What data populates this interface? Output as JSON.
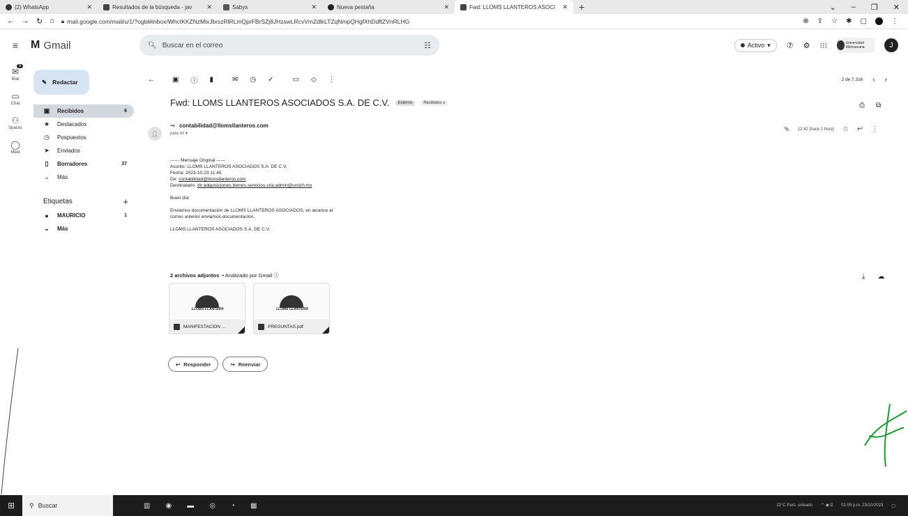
{
  "browser": {
    "tabs": [
      {
        "label": "(2) WhatsApp",
        "color": "#2a2a2a"
      },
      {
        "label": "Resultados de la búsqueda - jav",
        "color": "#2a2a2a"
      },
      {
        "label": "Sabys",
        "color": "#2a2a2a"
      },
      {
        "label": "Nueva pestaña",
        "color": "#2a2a2a"
      },
      {
        "label": "Fwd: LLOMS LLANTEROS ASOCI",
        "color": "#2a2a2a"
      }
    ],
    "url": "mail.google.com/mail/u/1/?ogbl#inbox/WhctKKZNzMlxJbrszRlRLmQprFBrSZj8JHzswLRcvVmZdlkLTZqNmpQHgfXhDdftZVnRLHG"
  },
  "gmail": {
    "logo": "Gmail",
    "search_placeholder": "Buscar en el correo",
    "status": "Activo",
    "org": "Universidad Michoacana",
    "avatar_letter": "J"
  },
  "rail": [
    {
      "label": "Mail",
      "badge": "9"
    },
    {
      "label": "Chat"
    },
    {
      "label": "Spaces"
    },
    {
      "label": "Meet"
    }
  ],
  "sidebar": {
    "compose": "Redactar",
    "items": [
      {
        "label": "Recibidos",
        "count": "6"
      },
      {
        "label": "Destacados",
        "count": ""
      },
      {
        "label": "Pospuestos",
        "count": ""
      },
      {
        "label": "Enviados",
        "count": ""
      },
      {
        "label": "Borradores",
        "count": "37"
      },
      {
        "label": "Más",
        "count": ""
      }
    ],
    "labels_title": "Etiquetas",
    "labels": [
      {
        "label": "MAURICIO",
        "count": "1"
      },
      {
        "label": "Más",
        "count": ""
      }
    ]
  },
  "toolbar": {
    "pager": "2 de 7.316"
  },
  "email": {
    "subject": "Fwd: LLOMS LLANTEROS ASOCIADOS S.A. DE C.V.",
    "tag_external": "Externo",
    "tag_inbox": "Recibidos x",
    "sender": "contabilidad@llomsllanteros.com",
    "to": "para mí",
    "time": "12:42 (hace 1 hora)",
    "body": {
      "header": "------ Mensaje Original ------",
      "asunto": "Asunto: LLOMS LLANTEROS ASOCIADOS S.A. DE C.V.",
      "fecha": "Fecha: 2023-10-23 11:45",
      "de_label": "De:",
      "de_link": "contabilidad@llomsllanteros.com",
      "dest_label": "Destinatario:",
      "dest_link": "dir.adquisiciones.bienes.servicios.sria.admin@umich.mx",
      "greeting": "Buen día:",
      "line1": "Enviamos documentación de LLOMS LLANTEROS ASOCIADOS, en alcance al",
      "line2": "correo anterior enviamos documentación.",
      "signature": "LLOMS LLANTEROS ASOCIADOS S.A. DE C.V."
    },
    "attachments_title": "2 archivos adjuntos",
    "attachments_scan": "• Analizado por Gmail ⓘ",
    "attachments": [
      {
        "name": "MANIFESTACION ...",
        "brand": "LLOMS LLANTERA"
      },
      {
        "name": "PREGUNTAS.pdf",
        "brand": "LLOMS LLANTERA"
      }
    ],
    "reply": "Responder",
    "forward": "Reenviar"
  },
  "taskbar": {
    "search": "Buscar",
    "weather": "22°C Parc. soleado",
    "datetime": "01:09 p.m. 23/10/2023"
  }
}
